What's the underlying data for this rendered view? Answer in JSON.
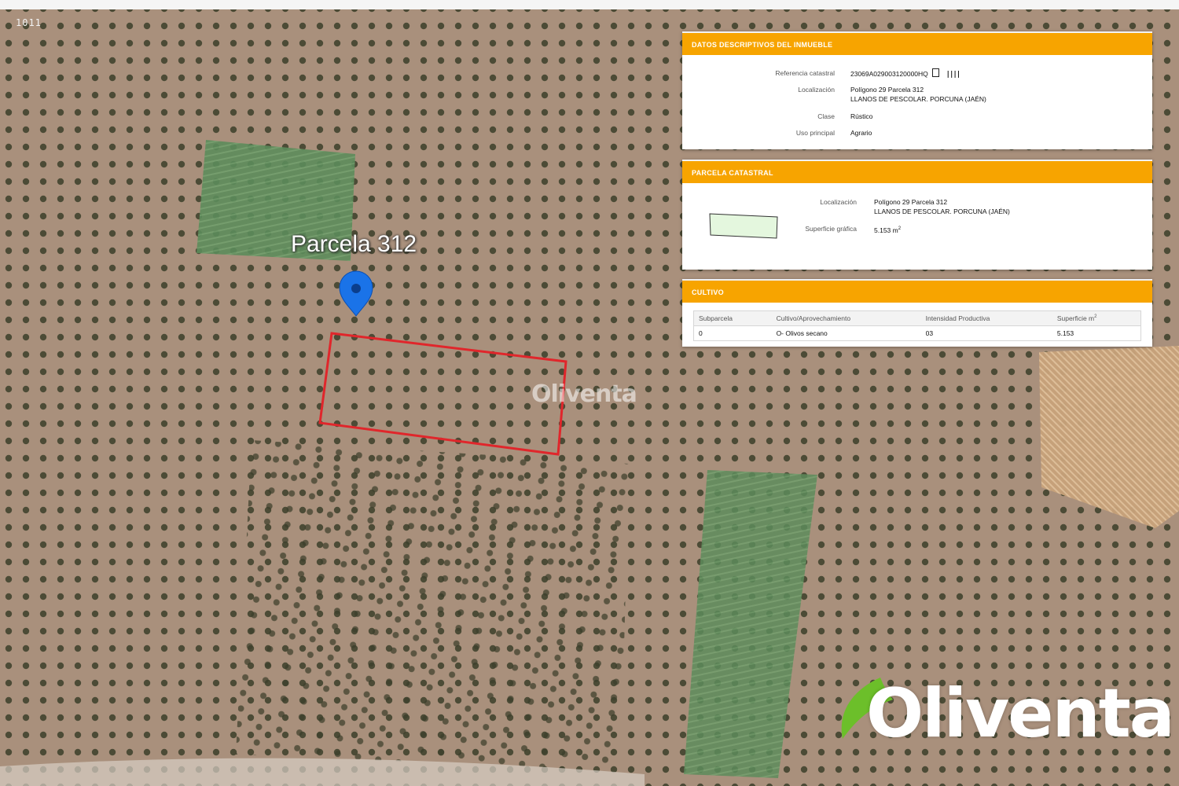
{
  "map": {
    "corner_label": "1011",
    "parcel_label": "Parcela 312",
    "watermark": "Oliventa",
    "brand_logo": "Oliventa",
    "colors": {
      "ground": "#a9907c",
      "tree": "#3a3d28",
      "green_field": "#5a8a5a",
      "parcel_outline": "#e0262b",
      "marker": "#1a73e8",
      "panel_header": "#f7a400",
      "logo_green": "#6cbf2a"
    }
  },
  "inmueble": {
    "header": "DATOS DESCRIPTIVOS DEL INMUEBLE",
    "ref_label": "Referencia catastral",
    "ref_value": "23069A029003120000HQ",
    "loc_label": "Localización",
    "loc_line1": "Polígono 29 Parcela 312",
    "loc_line2": "LLANOS DE PESCOLAR. PORCUNA (JAÉN)",
    "clase_label": "Clase",
    "clase_value": "Rústico",
    "uso_label": "Uso principal",
    "uso_value": "Agrario"
  },
  "parcela": {
    "header": "PARCELA CATASTRAL",
    "loc_label": "Localización",
    "loc_line1": "Polígono 29 Parcela 312",
    "loc_line2": "LLANOS DE PESCOLAR. PORCUNA (JAÉN)",
    "sup_label": "Superficie gráfica",
    "sup_value": "5.153 m",
    "sup_unit_sup": "2"
  },
  "cultivo": {
    "header": "CULTIVO",
    "columns": [
      "Subparcela",
      "Cultivo/Aprovechamiento",
      "Intensidad Productiva",
      "Superficie m"
    ],
    "col4_sup": "2",
    "rows": [
      [
        "0",
        "O- Olivos secano",
        "03",
        "5.153"
      ]
    ]
  }
}
